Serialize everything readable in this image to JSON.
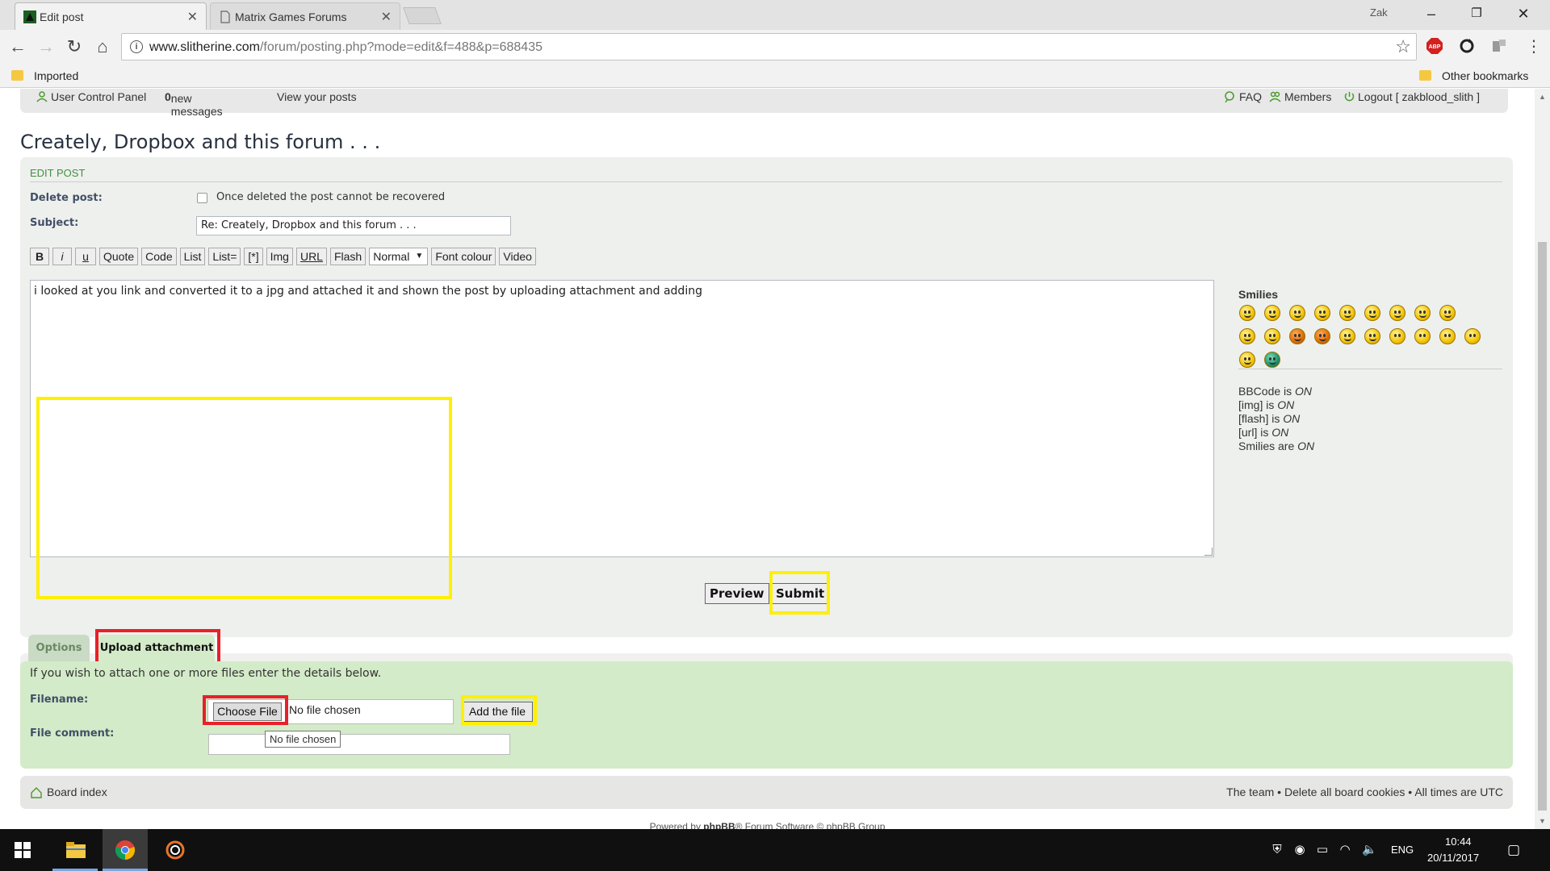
{
  "browser": {
    "user": "Zak",
    "tabs": [
      {
        "title": "Edit post",
        "active": true
      },
      {
        "title": "Matrix Games Forums",
        "active": false
      }
    ],
    "url_host": "www.slitherine.com",
    "url_path": "/forum/posting.php?mode=edit&f=488&p=688435",
    "bookmarks": {
      "left": "Imported",
      "right": "Other bookmarks"
    }
  },
  "ucp": {
    "user_control_panel": "User Control Panel",
    "new_count": "0",
    "new_messages": " new messages",
    "view_posts": "View your posts",
    "faq": "FAQ",
    "members": "Members",
    "logout": "Logout [ zakblood_slith ]"
  },
  "topic_title": "Creately, Dropbox and this forum . . .",
  "edit_post": {
    "heading": "EDIT POST",
    "delete_label": "Delete post:",
    "delete_note": "Once deleted the post cannot be recovered",
    "subject_label": "Subject:",
    "subject_value": "Re: Creately, Dropbox and this forum . . .",
    "bbcode_buttons": [
      "B",
      "i",
      "u",
      "Quote",
      "Code",
      "List",
      "List=",
      "[*]",
      "Img",
      "URL",
      "Flash"
    ],
    "size_select": "Normal",
    "font_colour": "Font colour",
    "video": "Video",
    "message": "i looked at you link and converted it to a jpg and attached it and shown the post by uploading attachment and adding",
    "smilies_title": "Smilies",
    "status": {
      "bbcode": "BBCode is ",
      "bbcode_state": "ON",
      "img": "[img] is ",
      "img_state": "ON",
      "flash": "[flash] is ",
      "flash_state": "ON",
      "url": "[url] is ",
      "url_state": "ON",
      "smilies": "Smilies are ",
      "smilies_state": "ON"
    }
  },
  "actions": {
    "preview": "Preview",
    "submit": "Submit"
  },
  "attach": {
    "tab_options": "Options",
    "tab_upload": "Upload attachment",
    "intro": "If you wish to attach one or more files enter the details below.",
    "filename_label": "Filename:",
    "choose_file": "Choose File",
    "no_file": "No file chosen",
    "add_file": "Add the file",
    "comment_label": "File comment:",
    "tooltip": "No file chosen"
  },
  "footer": {
    "board_index": "Board index",
    "team": "The team",
    "sep": " • ",
    "delete_cookies": "Delete all board cookies",
    "times": "All times are UTC",
    "powered_pre": "Powered by ",
    "powered_brand": "phpBB",
    "powered_post": "® Forum Software © phpBB Group"
  },
  "taskbar": {
    "lang": "ENG",
    "time": "10:44",
    "date": "20/11/2017"
  },
  "colors": {
    "highlight_yellow": "#ffef00",
    "highlight_red": "#e8202a",
    "upload_panel": "#d3ebc8"
  }
}
